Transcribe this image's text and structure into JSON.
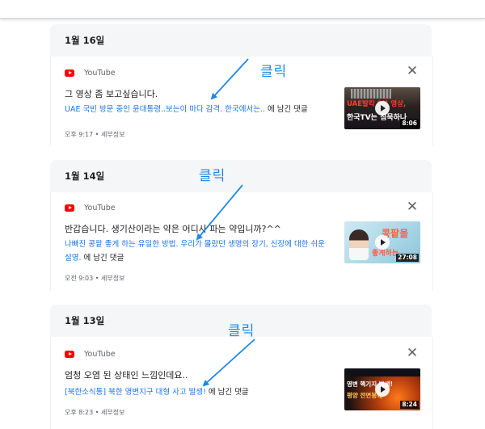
{
  "source_name": "YouTube",
  "annotation_label": "클릭",
  "annotation_color": "#1e88e5",
  "link_color": "#1a73e8",
  "groups": [
    {
      "date": "1월 16일",
      "comment": "그 영상 좀 보고싶습니다.",
      "video_link": "UAE 국빈 방문 중인 윤대통령..보는이 마다 감격. 한국에서는..",
      "link_suffix": " 에 남긴 댓글",
      "time": "오후 9:17",
      "details": "세부정보",
      "duration": "8:06",
      "thumb_caption_top": "UAE발칵 8분 영상,",
      "thumb_caption_bottom": "한국TV는 침묵하나"
    },
    {
      "date": "1월 14일",
      "comment": "반갑습니다. 생기산이라는 약은 어디사 파는 약입니까?^^",
      "video_link": "나빠진 콩팥 좋게 하는 유일한 방법. 우리가 몰랐던 생명의 장기, 신장에 대한 쉬운 설명.",
      "link_suffix": " 에 남긴 댓글",
      "time": "오전 9:03",
      "details": "세부정보",
      "duration": "27:08",
      "thumb_caption_top": "콩팥을",
      "thumb_caption_bottom": "좋게하는"
    },
    {
      "date": "1월 13일",
      "comment": "엄청 오염 된 상태인 느낌인데요..",
      "video_link": "[북한소식통] 북한 영변지구 대형 사고 발생!",
      "link_suffix": " 에 남긴 댓글",
      "time": "오후 8:23",
      "details": "세부정보",
      "duration": "8:24",
      "thumb_caption_top": "영변 핵기지 발생!",
      "thumb_caption_bottom": "평양 전면봉쇄"
    }
  ]
}
